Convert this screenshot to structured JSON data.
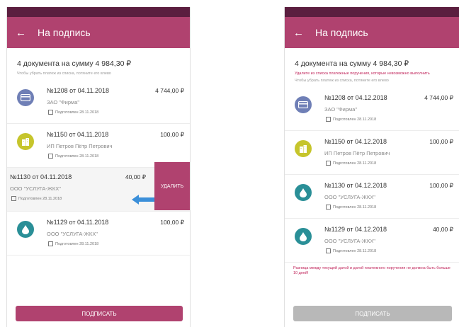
{
  "left": {
    "title": "На подпись",
    "summary": "4 документа на сумму 4 984,30 ₽",
    "hint": "Чтобы убрать платеж из списка, потяните его влево",
    "docs": [
      {
        "num": "№1208 от 04.11.2018",
        "amount": "4 744,00 ₽",
        "org": "ЗАО \"Фирма\"",
        "signed": "Подготовлен 28.11.2018"
      },
      {
        "num": "№1150 от 04.11.2018",
        "amount": "100,00 ₽",
        "org": "ИП Петров Пётр Петрович",
        "signed": "Подготовлен 28.11.2018"
      },
      {
        "num": "№1130 от 04.11.2018",
        "amount": "40,00 ₽",
        "org": "ООО \"УСЛУГА-ЖКХ\"",
        "signed": "Подготовлен 28.11.2018"
      },
      {
        "num": "№1129 от 04.11.2018",
        "amount": "100,00 ₽",
        "org": "ООО \"УСЛУГА-ЖКХ\"",
        "signed": "Подготовлен 28.11.2018"
      }
    ],
    "delete_label": "УДАЛИТЬ",
    "sign_label": "ПОДПИСАТЬ"
  },
  "right": {
    "title": "На подпись",
    "summary": "4 документа на сумму 4 984,30 ₽",
    "warning": "Удалите из списка платежные поручения, которые невозможно выполнить",
    "hint": "Чтобы убрать платеж из списка, потяните его влево",
    "docs": [
      {
        "num": "№1208 от 04.12.2018",
        "amount": "4 744,00 ₽",
        "org": "ЗАО \"Фирма\"",
        "signed": "Подготовлен 28.11.2018"
      },
      {
        "num": "№1150 от 04.12.2018",
        "amount": "100,00 ₽",
        "org": "ИП Петров Пётр Петрович",
        "signed": "Подготовлен 28.11.2018"
      },
      {
        "num": "№1130 от 04.12.2018",
        "amount": "100,00 ₽",
        "org": "ООО \"УСЛУГА-ЖКХ\"",
        "signed": "Подготовлен 28.11.2018"
      },
      {
        "num": "№1129 от 04.12.2018",
        "amount": "40,00 ₽",
        "org": "ООО \"УСЛУГА-ЖКХ\"",
        "signed": "Подготовлен 28.11.2018"
      }
    ],
    "error": "Разница между текущей датой и датой платежного поручения не должна быть больше 10 дней!",
    "sign_label": "ПОДПИСАТЬ"
  },
  "icons": {
    "card": "card-icon",
    "building": "building-icon",
    "drop": "water-drop-icon"
  },
  "colors": {
    "accent": "#b0426f",
    "statusbar": "#5b1e3f",
    "error": "#c0245a",
    "swipe_arrow": "#3b8fd9",
    "disabled": "#b8b8b8"
  }
}
